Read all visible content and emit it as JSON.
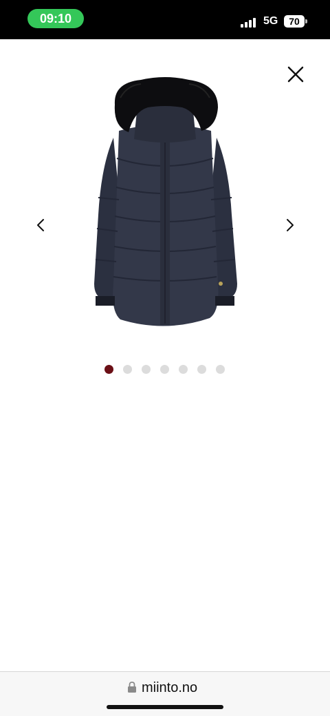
{
  "status_bar": {
    "time": "09:10",
    "network": "5G",
    "battery": "70",
    "time_pill_color": "#34c759"
  },
  "gallery": {
    "close_icon": "close-icon",
    "prev_icon": "chevron-left-icon",
    "next_icon": "chevron-right-icon",
    "product_image_alt": "Navy down parka with black fur-trimmed hood",
    "dot_count": 7,
    "active_dot_index": 0,
    "active_dot_color": "#6b0f16",
    "inactive_dot_color": "#dcdcdc"
  },
  "browser": {
    "url": "miinto.no",
    "lock_icon": "lock-icon"
  }
}
